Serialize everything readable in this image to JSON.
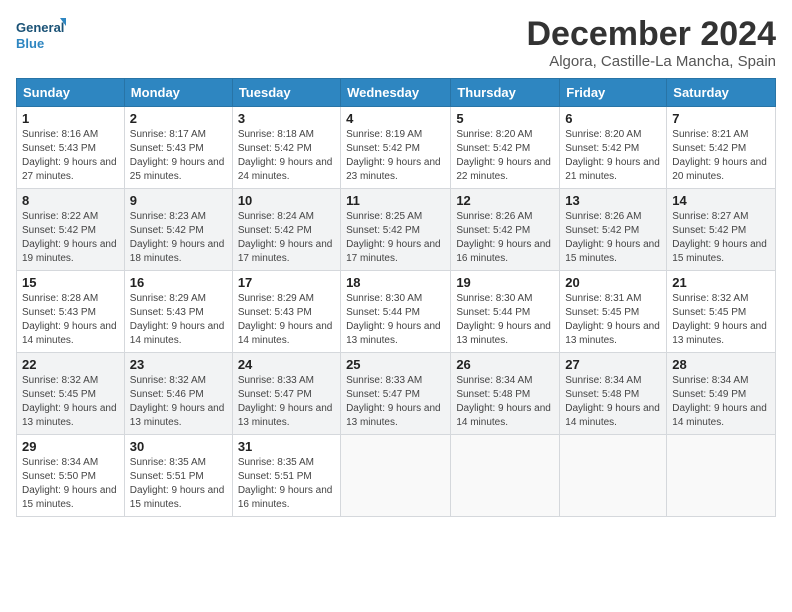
{
  "logo": {
    "general": "General",
    "blue": "Blue"
  },
  "title": "December 2024",
  "location": "Algora, Castille-La Mancha, Spain",
  "weekdays": [
    "Sunday",
    "Monday",
    "Tuesday",
    "Wednesday",
    "Thursday",
    "Friday",
    "Saturday"
  ],
  "weeks": [
    [
      {
        "day": "1",
        "info": "Sunrise: 8:16 AM\nSunset: 5:43 PM\nDaylight: 9 hours and 27 minutes."
      },
      {
        "day": "2",
        "info": "Sunrise: 8:17 AM\nSunset: 5:43 PM\nDaylight: 9 hours and 25 minutes."
      },
      {
        "day": "3",
        "info": "Sunrise: 8:18 AM\nSunset: 5:42 PM\nDaylight: 9 hours and 24 minutes."
      },
      {
        "day": "4",
        "info": "Sunrise: 8:19 AM\nSunset: 5:42 PM\nDaylight: 9 hours and 23 minutes."
      },
      {
        "day": "5",
        "info": "Sunrise: 8:20 AM\nSunset: 5:42 PM\nDaylight: 9 hours and 22 minutes."
      },
      {
        "day": "6",
        "info": "Sunrise: 8:20 AM\nSunset: 5:42 PM\nDaylight: 9 hours and 21 minutes."
      },
      {
        "day": "7",
        "info": "Sunrise: 8:21 AM\nSunset: 5:42 PM\nDaylight: 9 hours and 20 minutes."
      }
    ],
    [
      {
        "day": "8",
        "info": "Sunrise: 8:22 AM\nSunset: 5:42 PM\nDaylight: 9 hours and 19 minutes."
      },
      {
        "day": "9",
        "info": "Sunrise: 8:23 AM\nSunset: 5:42 PM\nDaylight: 9 hours and 18 minutes."
      },
      {
        "day": "10",
        "info": "Sunrise: 8:24 AM\nSunset: 5:42 PM\nDaylight: 9 hours and 17 minutes."
      },
      {
        "day": "11",
        "info": "Sunrise: 8:25 AM\nSunset: 5:42 PM\nDaylight: 9 hours and 17 minutes."
      },
      {
        "day": "12",
        "info": "Sunrise: 8:26 AM\nSunset: 5:42 PM\nDaylight: 9 hours and 16 minutes."
      },
      {
        "day": "13",
        "info": "Sunrise: 8:26 AM\nSunset: 5:42 PM\nDaylight: 9 hours and 15 minutes."
      },
      {
        "day": "14",
        "info": "Sunrise: 8:27 AM\nSunset: 5:42 PM\nDaylight: 9 hours and 15 minutes."
      }
    ],
    [
      {
        "day": "15",
        "info": "Sunrise: 8:28 AM\nSunset: 5:43 PM\nDaylight: 9 hours and 14 minutes."
      },
      {
        "day": "16",
        "info": "Sunrise: 8:29 AM\nSunset: 5:43 PM\nDaylight: 9 hours and 14 minutes."
      },
      {
        "day": "17",
        "info": "Sunrise: 8:29 AM\nSunset: 5:43 PM\nDaylight: 9 hours and 14 minutes."
      },
      {
        "day": "18",
        "info": "Sunrise: 8:30 AM\nSunset: 5:44 PM\nDaylight: 9 hours and 13 minutes."
      },
      {
        "day": "19",
        "info": "Sunrise: 8:30 AM\nSunset: 5:44 PM\nDaylight: 9 hours and 13 minutes."
      },
      {
        "day": "20",
        "info": "Sunrise: 8:31 AM\nSunset: 5:45 PM\nDaylight: 9 hours and 13 minutes."
      },
      {
        "day": "21",
        "info": "Sunrise: 8:32 AM\nSunset: 5:45 PM\nDaylight: 9 hours and 13 minutes."
      }
    ],
    [
      {
        "day": "22",
        "info": "Sunrise: 8:32 AM\nSunset: 5:45 PM\nDaylight: 9 hours and 13 minutes."
      },
      {
        "day": "23",
        "info": "Sunrise: 8:32 AM\nSunset: 5:46 PM\nDaylight: 9 hours and 13 minutes."
      },
      {
        "day": "24",
        "info": "Sunrise: 8:33 AM\nSunset: 5:47 PM\nDaylight: 9 hours and 13 minutes."
      },
      {
        "day": "25",
        "info": "Sunrise: 8:33 AM\nSunset: 5:47 PM\nDaylight: 9 hours and 13 minutes."
      },
      {
        "day": "26",
        "info": "Sunrise: 8:34 AM\nSunset: 5:48 PM\nDaylight: 9 hours and 14 minutes."
      },
      {
        "day": "27",
        "info": "Sunrise: 8:34 AM\nSunset: 5:48 PM\nDaylight: 9 hours and 14 minutes."
      },
      {
        "day": "28",
        "info": "Sunrise: 8:34 AM\nSunset: 5:49 PM\nDaylight: 9 hours and 14 minutes."
      }
    ],
    [
      {
        "day": "29",
        "info": "Sunrise: 8:34 AM\nSunset: 5:50 PM\nDaylight: 9 hours and 15 minutes."
      },
      {
        "day": "30",
        "info": "Sunrise: 8:35 AM\nSunset: 5:51 PM\nDaylight: 9 hours and 15 minutes."
      },
      {
        "day": "31",
        "info": "Sunrise: 8:35 AM\nSunset: 5:51 PM\nDaylight: 9 hours and 16 minutes."
      },
      null,
      null,
      null,
      null
    ]
  ]
}
